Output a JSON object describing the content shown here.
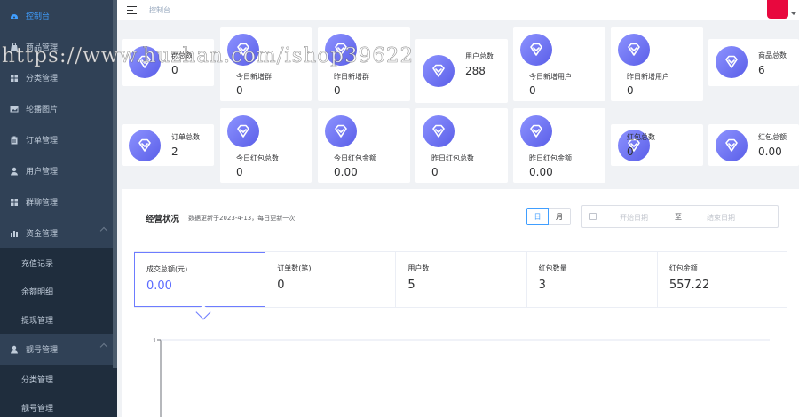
{
  "sidebar": {
    "items": [
      {
        "label": "控制台",
        "icon": "dashboard-icon"
      },
      {
        "label": "商品管理",
        "icon": "bag-icon"
      },
      {
        "label": "分类管理",
        "icon": "grid-icon"
      },
      {
        "label": "轮播图片",
        "icon": "image-icon"
      },
      {
        "label": "订单管理",
        "icon": "clipboard-icon"
      },
      {
        "label": "用户管理",
        "icon": "user-icon"
      },
      {
        "label": "群聊管理",
        "icon": "grid-icon"
      },
      {
        "label": "资金管理",
        "icon": "bar-chart-icon"
      }
    ],
    "fund_sub": [
      "充值记录",
      "余额明细",
      "提现管理"
    ],
    "account_label": "靓号管理",
    "account_sub": [
      "分类管理",
      "靓号管理"
    ]
  },
  "header": {
    "breadcrumb": "控制台"
  },
  "stats_row1": [
    {
      "label": "群总数",
      "value": "0"
    },
    {
      "label": "今日新增群",
      "value": "0"
    },
    {
      "label": "昨日新增群",
      "value": "0"
    },
    {
      "label": "用户总数",
      "value": "288"
    },
    {
      "label": "今日新增用户",
      "value": "0"
    },
    {
      "label": "昨日新增用户",
      "value": "0"
    },
    {
      "label": "商品总数",
      "value": "6"
    }
  ],
  "stats_row2": [
    {
      "label": "订单总数",
      "value": "2"
    },
    {
      "label": "今日红包总数",
      "value": "0"
    },
    {
      "label": "今日红包金额",
      "value": "0.00"
    },
    {
      "label": "昨日红包总数",
      "value": "0"
    },
    {
      "label": "昨日红包金额",
      "value": "0.00"
    },
    {
      "label": "红包总数",
      "value": "0"
    },
    {
      "label": "红包总额",
      "value": "0.00"
    }
  ],
  "business": {
    "title": "经营状况",
    "subtitle": "数据更新于2023-4-13，每日更新一次",
    "day_label": "日",
    "month_label": "月",
    "start_placeholder": "开始日期",
    "range_sep": "至",
    "end_placeholder": "结束日期",
    "metrics": [
      {
        "label": "成交总额(元)",
        "value": "0.00"
      },
      {
        "label": "订单数(笔)",
        "value": "0"
      },
      {
        "label": "用户数",
        "value": "5"
      },
      {
        "label": "红包数量",
        "value": "3"
      },
      {
        "label": "红包金额",
        "value": "557.22"
      }
    ]
  },
  "chart_data": {
    "type": "line",
    "y_tick_labels": [
      "1"
    ],
    "ylim": [
      0,
      1
    ],
    "series": []
  },
  "watermark": "https://www.huzhan.com/ishop39622"
}
